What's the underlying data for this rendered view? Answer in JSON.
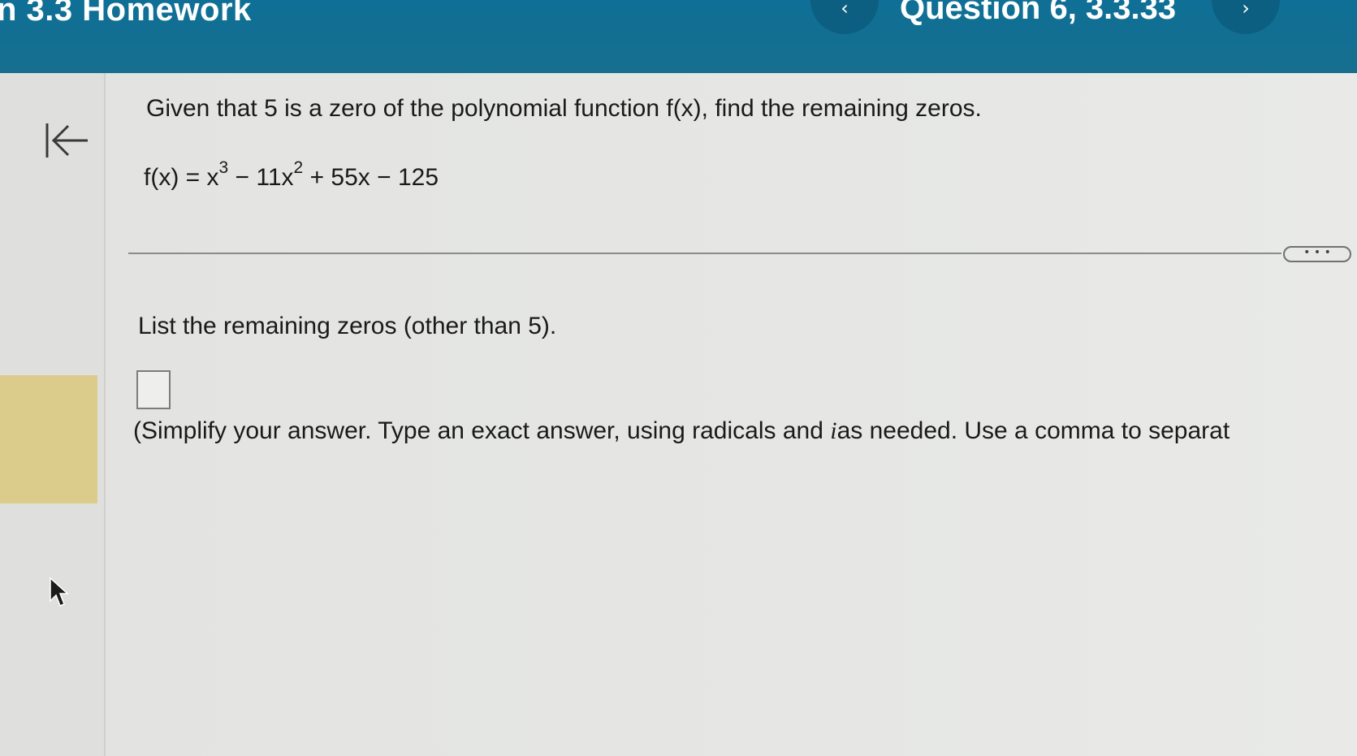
{
  "header": {
    "title": "n 3.3 Homework",
    "question_label": "Question 6, 3.3.33",
    "prev_icon": "chevron-left-icon",
    "next_icon": "chevron-right-icon",
    "prev_glyph": "‹",
    "next_glyph": "›"
  },
  "sidebar": {
    "back_icon": "collapse-left-icon"
  },
  "question": {
    "prompt": "Given that 5 is a zero of the polynomial function f(x), find the remaining zeros.",
    "equation": {
      "lhs": "f(x) = x",
      "exp1": "3",
      "mid": " − 11x",
      "exp2": "2",
      "tail": " + 55x − 125"
    }
  },
  "more_button": {
    "label": "• • •"
  },
  "answer": {
    "instruction": "List the remaining zeros (other than 5).",
    "value": "",
    "hint_pre": "(Simplify your answer. Type an exact answer, using radicals and ",
    "hint_var": "i",
    "hint_post": "as needed. Use a comma to separat"
  },
  "colors": {
    "header_bg": "#0f6f96",
    "highlight": "#dccc8c",
    "page_bg": "#e4e5e3"
  }
}
